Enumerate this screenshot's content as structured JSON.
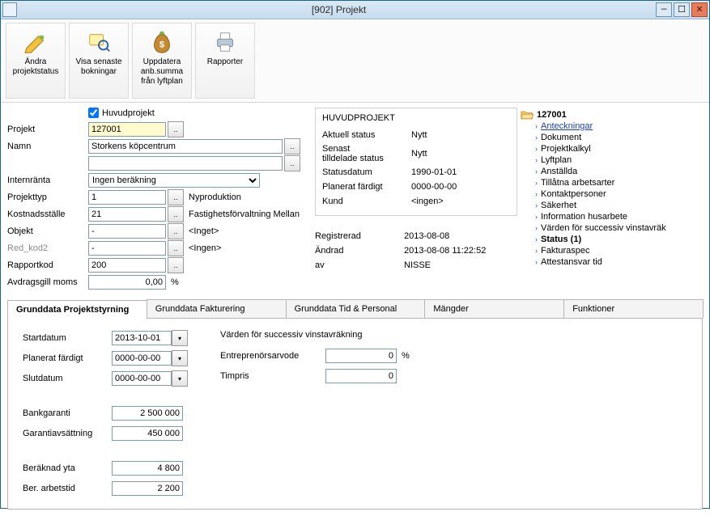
{
  "window": {
    "title": "[902]  Projekt"
  },
  "toolbar": {
    "b0": "Ändra\nprojektstatus",
    "b1": "Visa senaste\nbokningar",
    "b2": "Uppdatera\nanb.summa\nfrån lyftplan",
    "b3": "Rapporter"
  },
  "form": {
    "huvudprojekt_label": "Huvudprojekt",
    "projekt_label": "Projekt",
    "projekt_value": "127001",
    "namn_label": "Namn",
    "namn_value": "Storkens köpcentrum",
    "namn_value2": "",
    "internranta_label": "Internränta",
    "internranta_value": "Ingen beräkning",
    "projekttyp_label": "Projekttyp",
    "projekttyp_value": "1",
    "projekttyp_after": "Nyproduktion",
    "kostnadsstalle_label": "Kostnadsställe",
    "kostnadsstalle_value": "21",
    "kostnadsstalle_after": "Fastighetsförvaltning Mellan",
    "objekt_label": "Objekt",
    "objekt_value": "-",
    "objekt_after": "<Inget>",
    "redkod_label": "Red_kod2",
    "redkod_value": "-",
    "redkod_after": "<Ingen>",
    "rapportkod_label": "Rapportkod",
    "rapportkod_value": "200",
    "moms_label": "Avdragsgill moms",
    "moms_value": "0,00",
    "moms_unit": "%"
  },
  "status": {
    "header": "HUVUDPROJEKT",
    "aktuell_k": "Aktuell status",
    "aktuell_v": "Nytt",
    "senast_k": "Senast\ntilldelade status",
    "senast_v": "Nytt",
    "statusdatum_k": "Statusdatum",
    "statusdatum_v": "1990-01-01",
    "planerat_k": "Planerat färdigt",
    "planerat_v": "0000-00-00",
    "kund_k": "Kund",
    "kund_v": "<ingen>"
  },
  "meta": {
    "reg_k": "Registrerad",
    "reg_v": "2013-08-08",
    "andrad_k": "Ändrad",
    "andrad_v": "2013-08-08 11:22:52",
    "av_k": "av",
    "av_v": "NISSE"
  },
  "tree": {
    "root": "127001",
    "i0": "Anteckningar",
    "i1": "Dokument",
    "i2": "Projektkalkyl",
    "i3": "Lyftplan",
    "i4": "Anställda",
    "i5": "Tillåtna arbetsarter",
    "i6": "Kontaktpersoner",
    "i7": "Säkerhet",
    "i8": "Information husarbete",
    "i9": "Värden för successiv vinstavräk",
    "i10": "Status (1)",
    "i11": "Fakturaspec",
    "i12": "Attestansvar tid"
  },
  "tabs": {
    "t0": "Grunddata Projektstyrning",
    "t1": "Grunddata Fakturering",
    "t2": "Grunddata Tid & Personal",
    "t3": "Mängder",
    "t4": "Funktioner"
  },
  "tab0": {
    "startdatum_k": "Startdatum",
    "startdatum_v": "2013-10-01",
    "planerat_k": "Planerat färdigt",
    "planerat_v": "0000-00-00",
    "slutdatum_k": "Slutdatum",
    "slutdatum_v": "0000-00-00",
    "bankgaranti_k": "Bankgaranti",
    "bankgaranti_v": "2 500 000",
    "garantiavs_k": "Garantiavsättning",
    "garantiavs_v": "450 000",
    "yta_k": "Beräknad yta",
    "yta_v": "4 800",
    "arbetstid_k": "Ber. arbetstid",
    "arbetstid_v": "2 200",
    "succ_header": "Värden för successiv vinstavräkning",
    "ent_k": "Entreprenörsarvode",
    "ent_v": "0",
    "ent_unit": "%",
    "timpris_k": "Timpris",
    "timpris_v": "0"
  }
}
